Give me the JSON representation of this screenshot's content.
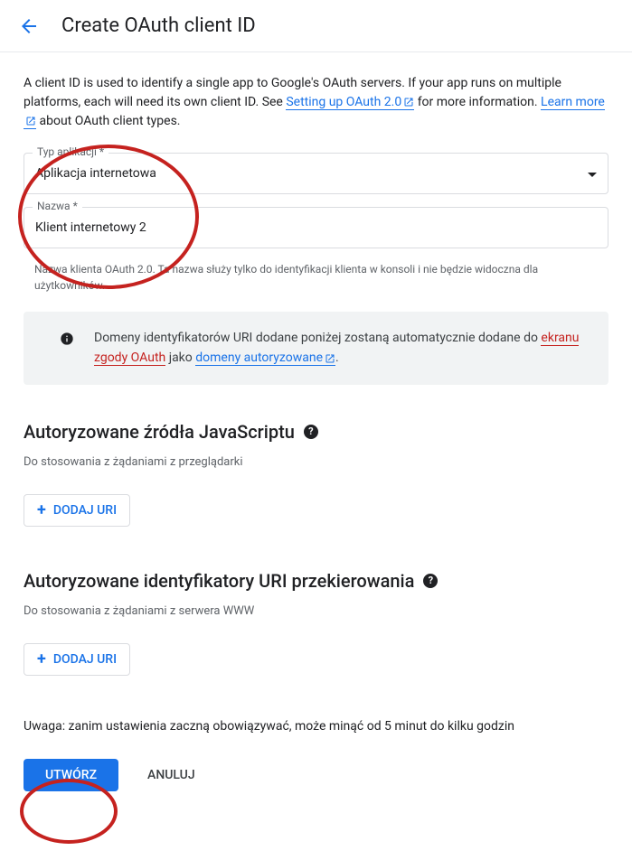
{
  "header": {
    "title": "Create OAuth client ID"
  },
  "intro": {
    "text_before_link1": "A client ID is used to identify a single app to Google's OAuth servers. If your app runs on multiple platforms, each will need its own client ID. See ",
    "link1": "Setting up OAuth 2.0",
    "text_mid": " for more information. ",
    "link2": "Learn more",
    "text_after_link2": " about OAuth client types."
  },
  "fields": {
    "app_type": {
      "label": "Typ aplikacji *",
      "value": "Aplikacja internetowa"
    },
    "name": {
      "label": "Nazwa *",
      "value": "Klient internetowy 2",
      "helper": "Nazwa klienta OAuth 2.0. Ta nazwa służy tylko do identyfikacji klienta w konsoli i nie będzie widoczna dla użytkowników."
    }
  },
  "banner": {
    "text_before": "Domeny identyfikatorów URI dodane poniżej zostaną automatycznie dodane do ",
    "link1": "ekranu zgody OAuth",
    "text_mid": " jako ",
    "link2": "domeny autoryzowane",
    "text_after": "."
  },
  "sections": {
    "js_origins": {
      "title": "Autoryzowane źródła JavaScriptu",
      "subtitle": "Do stosowania z żądaniami z przeglądarki",
      "add_button": "DODAJ URI"
    },
    "redirect_uris": {
      "title": "Autoryzowane identyfikatory URI przekierowania",
      "subtitle": "Do stosowania z żądaniami z serwera WWW",
      "add_button": "DODAJ URI"
    }
  },
  "note": "Uwaga: zanim ustawienia zaczną obowiązywać, może minąć od 5 minut do kilku godzin",
  "actions": {
    "create": "UTWÓRZ",
    "cancel": "ANULUJ"
  },
  "colors": {
    "primary": "#1a73e8",
    "annotation": "#c5221f"
  }
}
